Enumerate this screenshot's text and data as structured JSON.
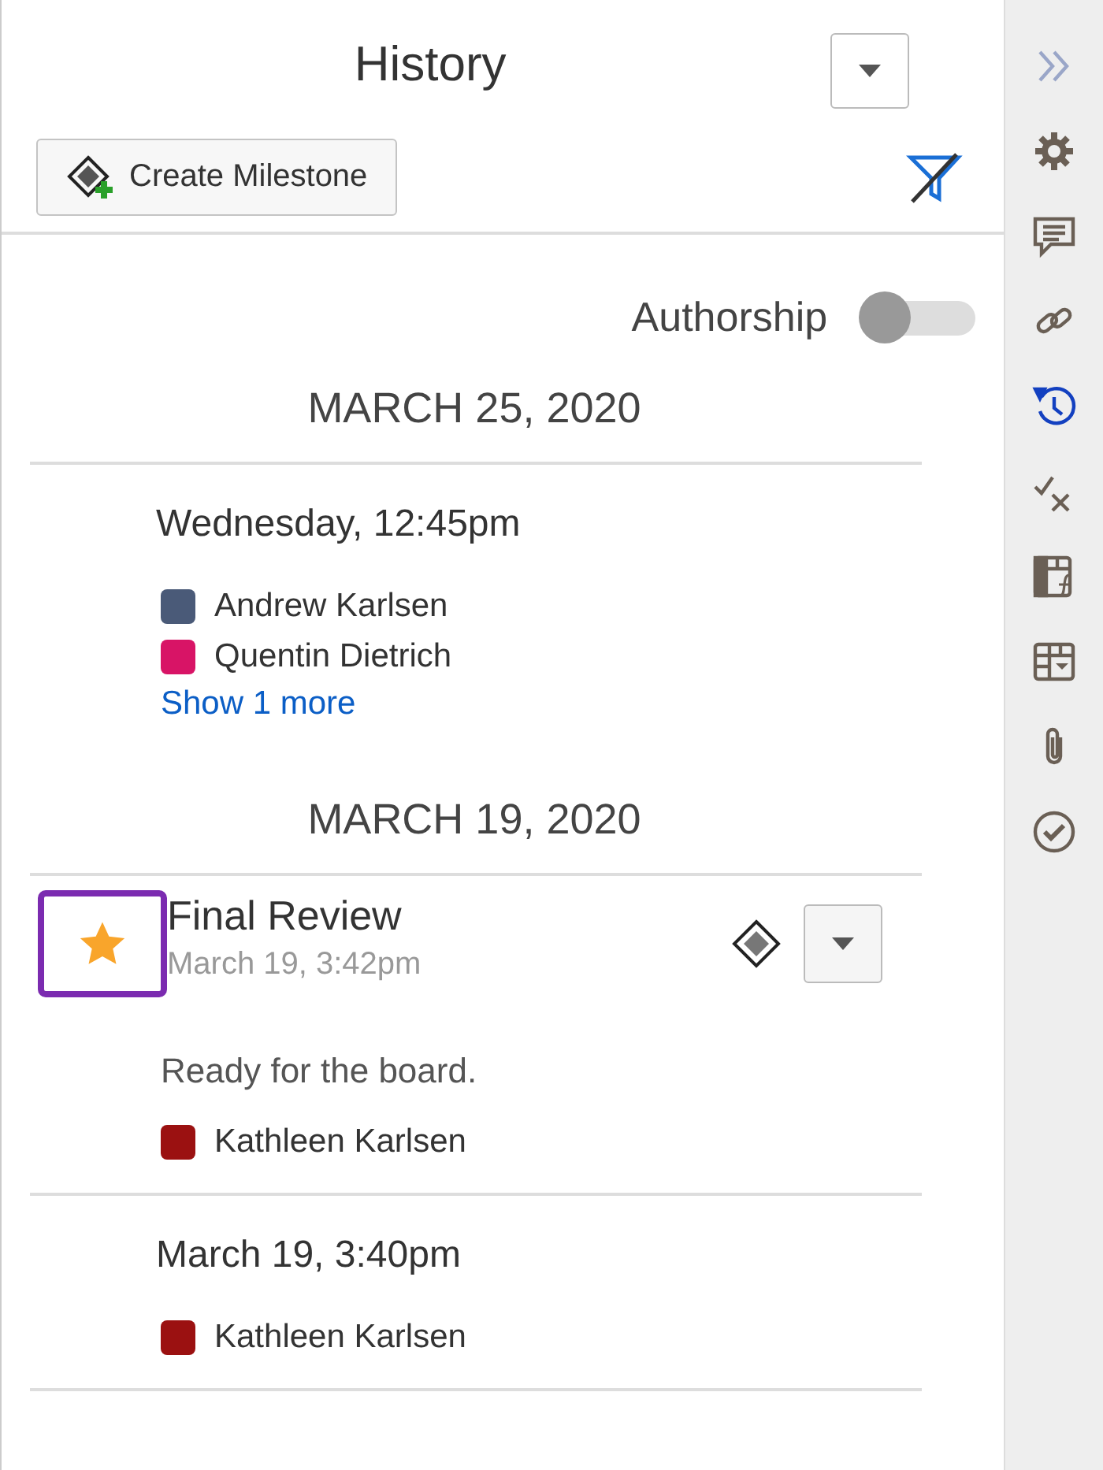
{
  "panel": {
    "title": "History",
    "create_button": "Create Milestone",
    "authorship": {
      "label": "Authorship",
      "on": false
    }
  },
  "groups": [
    {
      "date": "MARCH 25, 2020",
      "entries": [
        {
          "kind": "activity",
          "time": "Wednesday, 12:45pm",
          "authors": [
            {
              "name": "Andrew Karlsen",
              "color": "#4a5a78"
            },
            {
              "name": "Quentin Dietrich",
              "color": "#d81466"
            }
          ],
          "more_link": "Show 1 more"
        }
      ]
    },
    {
      "date": "MARCH 19, 2020",
      "entries": [
        {
          "kind": "milestone",
          "title": "Final Review",
          "subtitle": "March 19, 3:42pm",
          "starred": true,
          "focused": true,
          "note": "Ready for the board.",
          "authors": [
            {
              "name": "Kathleen Karlsen",
              "color": "#9b1111"
            }
          ]
        },
        {
          "kind": "activity",
          "time": "March 19, 3:40pm",
          "authors": [
            {
              "name": "Kathleen Karlsen",
              "color": "#9b1111"
            }
          ]
        }
      ]
    }
  ],
  "rail": [
    {
      "kind": "collapse",
      "selected": false
    },
    {
      "kind": "settings",
      "selected": false
    },
    {
      "kind": "comments",
      "selected": false
    },
    {
      "kind": "link",
      "selected": false
    },
    {
      "kind": "history",
      "selected": true
    },
    {
      "kind": "proofing",
      "selected": false
    },
    {
      "kind": "formula",
      "selected": false
    },
    {
      "kind": "table",
      "selected": false
    },
    {
      "kind": "attachment",
      "selected": false
    },
    {
      "kind": "approval",
      "selected": false
    }
  ]
}
